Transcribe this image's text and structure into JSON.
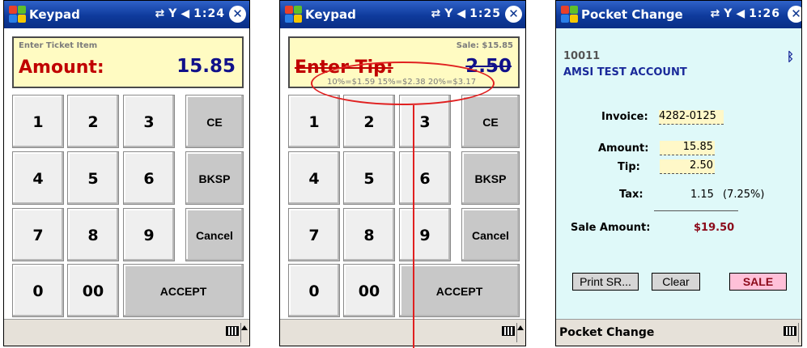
{
  "colors": {
    "titlebar": "#0e3a9c",
    "display_bg": "#fffbc2",
    "label_red": "#c00000",
    "value_blue": "#10108a",
    "pc_bg": "#dff9f9",
    "sale_btn": "#ffc0d8",
    "annotation": "#e02020"
  },
  "screens": [
    {
      "title": "Keypad",
      "tray_time": "1:24",
      "display": {
        "hint": "Enter Ticket Item",
        "label": "Amount:",
        "value": "15.85"
      },
      "keys": {
        "k1": "1",
        "k2": "2",
        "k3": "3",
        "ce": "CE",
        "k4": "4",
        "k5": "5",
        "k6": "6",
        "bksp": "BKSP",
        "k7": "7",
        "k8": "8",
        "k9": "9",
        "cancel": "Cancel",
        "k0": "0",
        "k00": "00",
        "accept": "ACCEPT"
      }
    },
    {
      "title": "Keypad",
      "tray_time": "1:25",
      "display": {
        "sale": "Sale: $15.85",
        "label": "Enter Tip:",
        "value": "2.50",
        "tips": "10%=$1.59  15%=$2.38  20%=$3.17"
      },
      "keys": {
        "k1": "1",
        "k2": "2",
        "k3": "3",
        "ce": "CE",
        "k4": "4",
        "k5": "5",
        "k6": "6",
        "bksp": "BKSP",
        "k7": "7",
        "k8": "8",
        "k9": "9",
        "cancel": "Cancel",
        "k0": "0",
        "k00": "00",
        "accept": "ACCEPT"
      }
    },
    {
      "title": "Pocket Change",
      "tray_time": "1:26",
      "account_id": "10011",
      "account_name": "AMSI TEST ACCOUNT",
      "invoice_label": "Invoice:",
      "invoice_value": "4282-0125",
      "amount_label": "Amount:",
      "amount_value": "15.85",
      "tip_label": "Tip:",
      "tip_value": "2.50",
      "tax_label": "Tax:",
      "tax_value": "1.15",
      "tax_rate": "(7.25%)",
      "sale_amount_label": "Sale Amount:",
      "sale_amount_value": "$19.50",
      "buttons": {
        "print": "Print SR...",
        "clear": "Clear",
        "sale": "SALE"
      },
      "bottom_title": "Pocket Change"
    }
  ]
}
